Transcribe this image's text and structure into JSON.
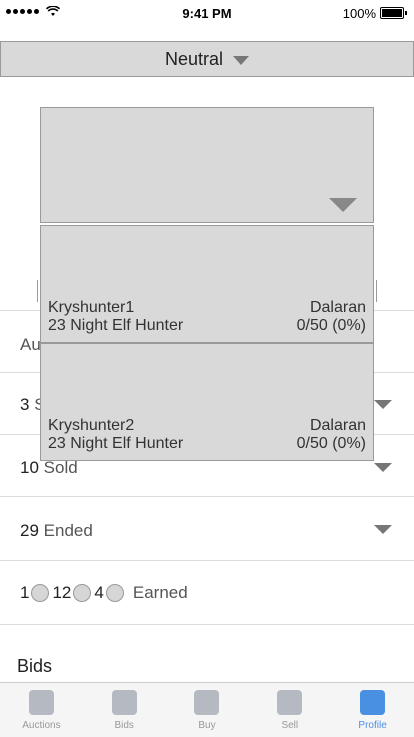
{
  "status_bar": {
    "time": "9:41 PM",
    "battery": "100%"
  },
  "faction_select": {
    "label": "Neutral"
  },
  "rows": [
    {
      "count": "",
      "label": "Au"
    },
    {
      "count": "3",
      "label": "S"
    },
    {
      "count": "10",
      "label": "Sold"
    },
    {
      "count": "29",
      "label": "Ended"
    }
  ],
  "earned": {
    "gold": "1",
    "silver": "12",
    "copper": "4",
    "label": "Earned"
  },
  "bids_title": "Bids",
  "character_dropdown": {
    "items": [
      {
        "name": "Kryshunter1",
        "realm": "Dalaran",
        "description": "23 Night Elf Hunter",
        "progress": "0/50 (0%)"
      },
      {
        "name": "Kryshunter2",
        "realm": "Dalaran",
        "description": "23 Night Elf Hunter",
        "progress": "0/50 (0%)"
      }
    ]
  },
  "tabs": [
    {
      "label": "Auctions",
      "active": false
    },
    {
      "label": "Bids",
      "active": false
    },
    {
      "label": "Buy",
      "active": false
    },
    {
      "label": "Sell",
      "active": false
    },
    {
      "label": "Profile",
      "active": true
    }
  ],
  "colors": {
    "accent": "#4a90e2",
    "select_bg": "#d9d9d9"
  }
}
